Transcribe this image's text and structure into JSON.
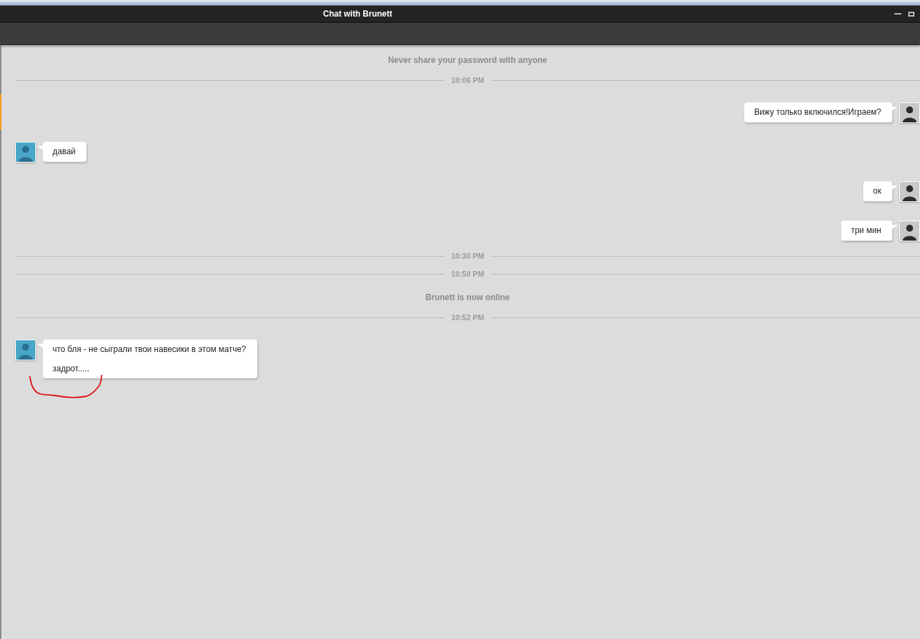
{
  "window": {
    "title": "Chat with Brunett"
  },
  "feed": [
    {
      "kind": "notice",
      "text": "Never share your password with anyone"
    },
    {
      "kind": "time",
      "text": "10:06 PM"
    },
    {
      "kind": "message",
      "outgoing": true,
      "lines": [
        "Вижу только включился!Играем?"
      ]
    },
    {
      "kind": "message",
      "outgoing": false,
      "lines": [
        "давай"
      ]
    },
    {
      "kind": "message",
      "outgoing": true,
      "lines": [
        "ок"
      ]
    },
    {
      "kind": "message",
      "outgoing": true,
      "lines": [
        "три мин"
      ]
    },
    {
      "kind": "time",
      "text": "10:30 PM"
    },
    {
      "kind": "time",
      "text": "10:50 PM"
    },
    {
      "kind": "notice",
      "text": "Brunett is now online"
    },
    {
      "kind": "time",
      "text": "10:52 PM"
    },
    {
      "kind": "message",
      "outgoing": false,
      "lines": [
        "что бля - не сыграли твои навесики в этом матче?",
        "задрот....."
      ]
    }
  ]
}
